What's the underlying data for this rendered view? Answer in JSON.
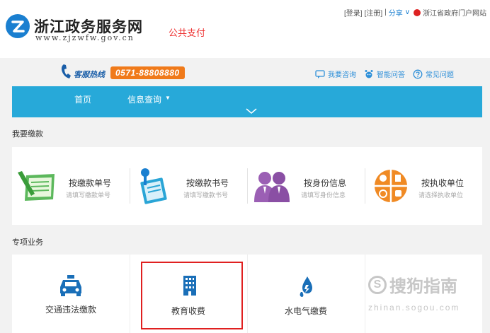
{
  "header": {
    "site_name": "浙江政务服务网",
    "site_url": "www.zjzwfw.gov.cn",
    "subtitle": "公共支付",
    "links": {
      "login": "[登录]",
      "register": "[注册]",
      "separator": "|",
      "share": "分享",
      "share_arrow": "∨",
      "portal": "浙江省政府门户网站"
    }
  },
  "service_bar": {
    "hotline_label": "客服热线",
    "hotline_number": "0571-88808880",
    "links": [
      "我要咨询",
      "智能问答",
      "常见问题"
    ]
  },
  "nav": {
    "items": [
      "首页",
      "信息查询"
    ],
    "dropdown_arrow": "▼"
  },
  "pay_section": {
    "title": "我要缴款",
    "items": [
      {
        "label": "按缴款单号",
        "hint": "请填写缴款单号",
        "icon": "document-pen-icon"
      },
      {
        "label": "按缴款书号",
        "hint": "请填写缴款书号",
        "icon": "pin-notebook-icon"
      },
      {
        "label": "按身份信息",
        "hint": "请填写身份信息",
        "icon": "people-icon"
      },
      {
        "label": "按执收单位",
        "hint": "请选择执收单位",
        "icon": "pie-money-icon"
      }
    ]
  },
  "special_section": {
    "title": "专项业务",
    "items": [
      {
        "label": "交通违法缴款",
        "icon": "car-icon"
      },
      {
        "label": "教育收费",
        "icon": "building-icon"
      },
      {
        "label": "水电气缴费",
        "icon": "water-fire-icon"
      }
    ]
  },
  "watermark": {
    "text": "搜狗指南",
    "url": "zhinan.sogou.com",
    "logo_letter": "S"
  },
  "colors": {
    "primary": "#27a9d9",
    "brand_blue": "#1a7fd0",
    "orange": "#f07a1a",
    "highlight": "#e02020"
  }
}
